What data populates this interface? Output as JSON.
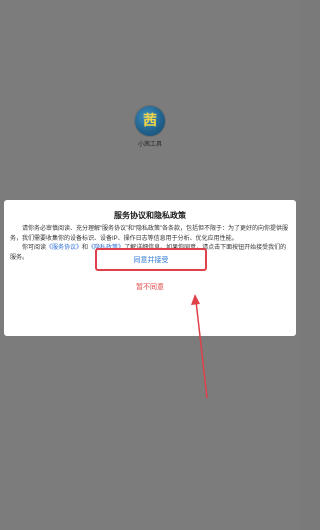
{
  "app": {
    "logo_text": "茜",
    "name": "小茜工具"
  },
  "dialog": {
    "title": "服务协议和隐私政策",
    "paragraph1": "请你务必审慎阅读、充分理解“服务协议”和“隐私政策”各条款，包括但不限于：为了更好的向你提供服务，我们需要收集你的设备标识、设备IP、操作日志等信息用于分析、优化应用性能。",
    "paragraph2_prefix": "你可阅读",
    "service_link": "《服务协议》",
    "and_text": "和",
    "privacy_link": "《隐私政策》",
    "paragraph2_suffix": "了解详细信息。如果你同意，请点击下面按钮开始接受我们的服务。",
    "accept_label": "同意并接受",
    "decline_label": "暂不同意"
  },
  "colors": {
    "highlight": "#e0404a",
    "link": "#2f6fd6",
    "decline": "#e04040"
  }
}
